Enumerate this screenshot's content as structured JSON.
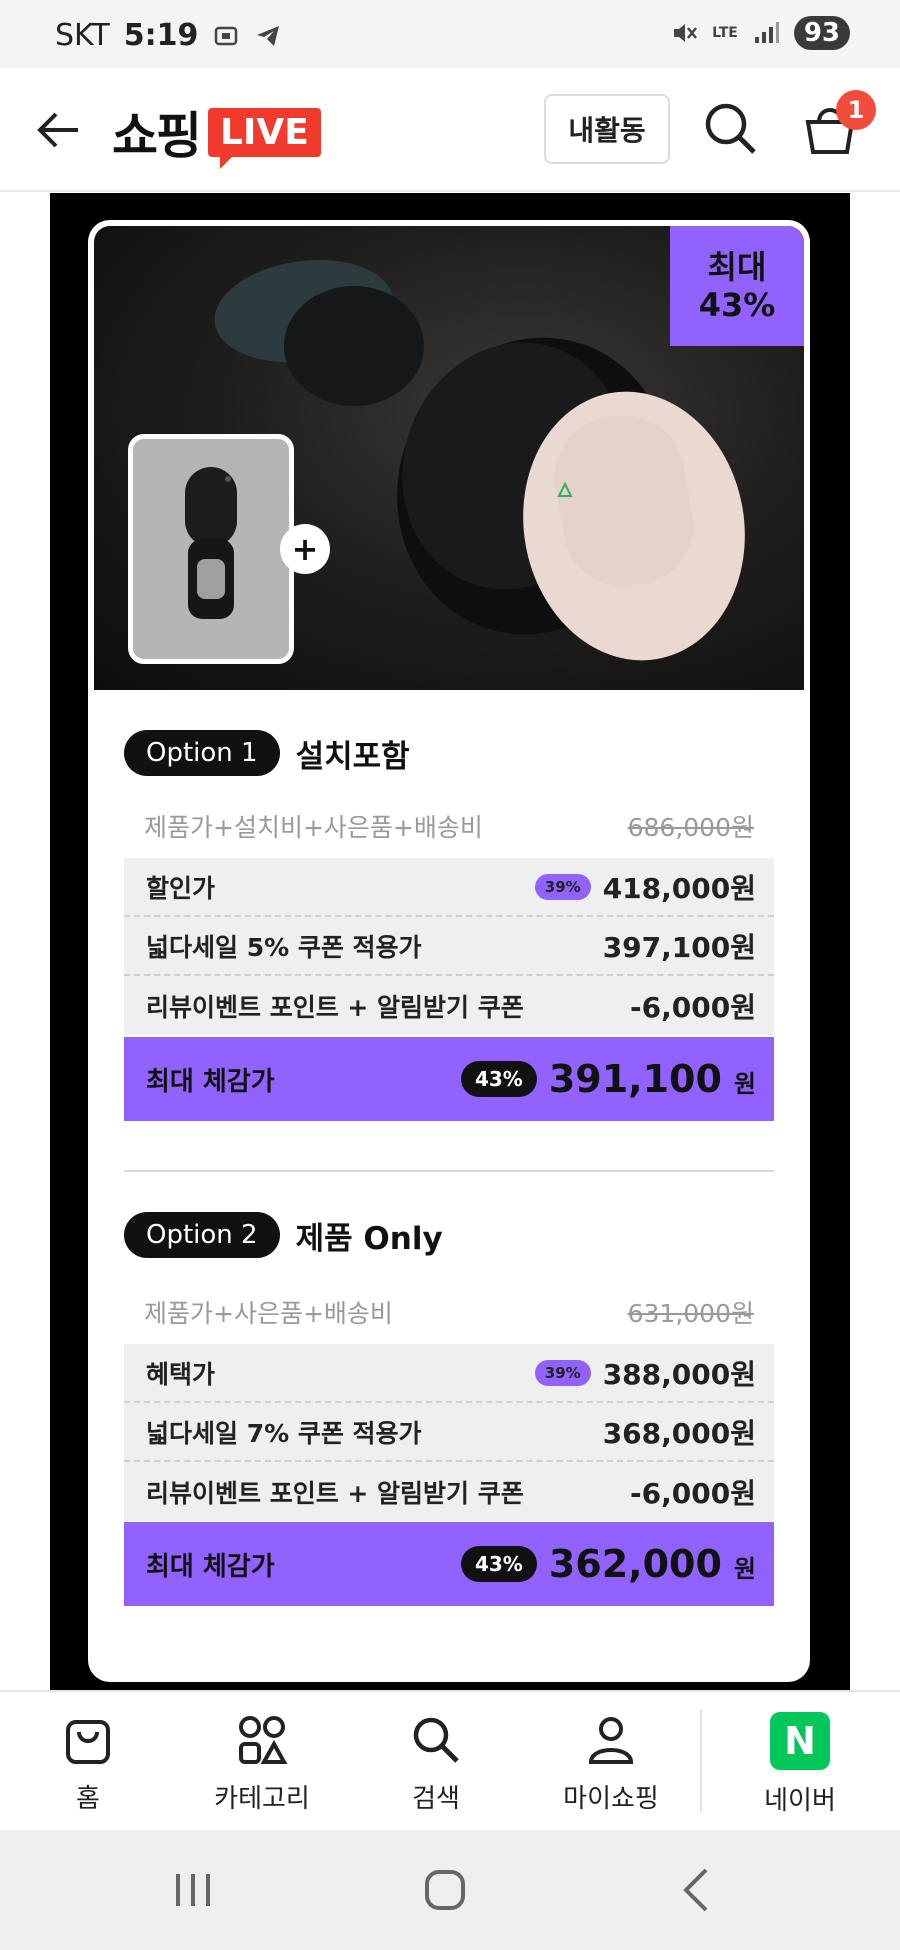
{
  "status_bar": {
    "carrier": "SKT",
    "time": "5:19",
    "network": "LTE",
    "battery": "93"
  },
  "header": {
    "logo_text": "쇼핑",
    "logo_live": "LIVE",
    "activity_label": "내활동",
    "cart_count": "1"
  },
  "hero": {
    "max_badge_line1": "최대",
    "max_badge_line2": "43%",
    "plus": "+"
  },
  "options": [
    {
      "pill": "Option 1",
      "title": "설치포함",
      "orig_label": "제품가+설치비+사은품+배송비",
      "orig_price": "686,000원",
      "rows": [
        {
          "label": "할인가",
          "pct": "39%",
          "value": "418,000원"
        },
        {
          "label": "넓다세일 5% 쿠폰 적용가",
          "value": "397,100원"
        },
        {
          "label": "리뷰이벤트 포인트 + 알림받기 쿠폰",
          "value": "-6,000원"
        }
      ],
      "final_label": "최대 체감가",
      "final_pct": "43%",
      "final_price": "391,100",
      "final_unit": "원"
    },
    {
      "pill": "Option 2",
      "title": "제품 Only",
      "orig_label": "제품가+사은품+배송비",
      "orig_price": "631,000원",
      "rows": [
        {
          "label": "혜택가",
          "pct": "39%",
          "value": "388,000원"
        },
        {
          "label": "넓다세일 7% 쿠폰 적용가",
          "value": "368,000원"
        },
        {
          "label": "리뷰이벤트 포인트 + 알림받기 쿠폰",
          "value": "-6,000원"
        }
      ],
      "final_label": "최대 체감가",
      "final_pct": "43%",
      "final_price": "362,000",
      "final_unit": "원"
    }
  ],
  "bottom_nav": {
    "home": "홈",
    "category": "카테고리",
    "search": "검색",
    "myshopping": "마이쇼핑",
    "naver": "네이버",
    "naver_logo": "N"
  },
  "colors": {
    "accent_purple": "#9262ff",
    "live_red": "#f03a2b",
    "naver_green": "#03c75a"
  },
  "icons": [
    "back-arrow-icon",
    "search-icon",
    "cart-icon",
    "home-bag-icon",
    "category-icon",
    "search-nav-icon",
    "person-icon",
    "naver-icon",
    "recent-apps-icon",
    "home-circle-icon",
    "back-icon"
  ]
}
